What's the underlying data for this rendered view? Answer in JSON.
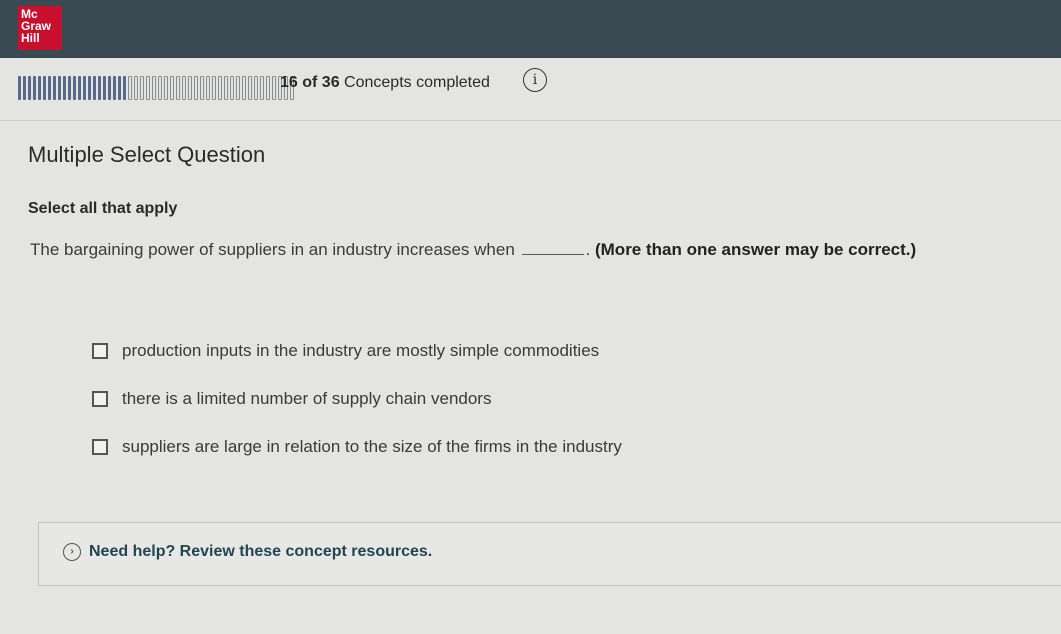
{
  "brand": {
    "logo_lines": [
      "Mc",
      "Graw",
      "Hill"
    ],
    "brand_color": "#c8102e"
  },
  "progress": {
    "completed": 16,
    "total": 36,
    "count_label": "16 of 36",
    "suffix_label": "Concepts completed",
    "fraction": 0.444,
    "info_icon": "info-icon"
  },
  "question": {
    "type_label": "Multiple Select Question",
    "instruction": "Select all that apply",
    "prompt_text": "The bargaining power of suppliers in an industry increases when",
    "prompt_end": ".",
    "prompt_note": "(More than one answer may be correct.)",
    "options": [
      {
        "label": "production inputs in the industry are mostly simple commodities",
        "checked": false
      },
      {
        "label": "there is a limited number of supply chain vendors",
        "checked": false
      },
      {
        "label": "suppliers are large in relation to the size of the firms in the industry",
        "checked": false
      }
    ]
  },
  "help": {
    "label": "Need help? Review these concept resources.",
    "icon": "chevron-right-circle-icon"
  }
}
